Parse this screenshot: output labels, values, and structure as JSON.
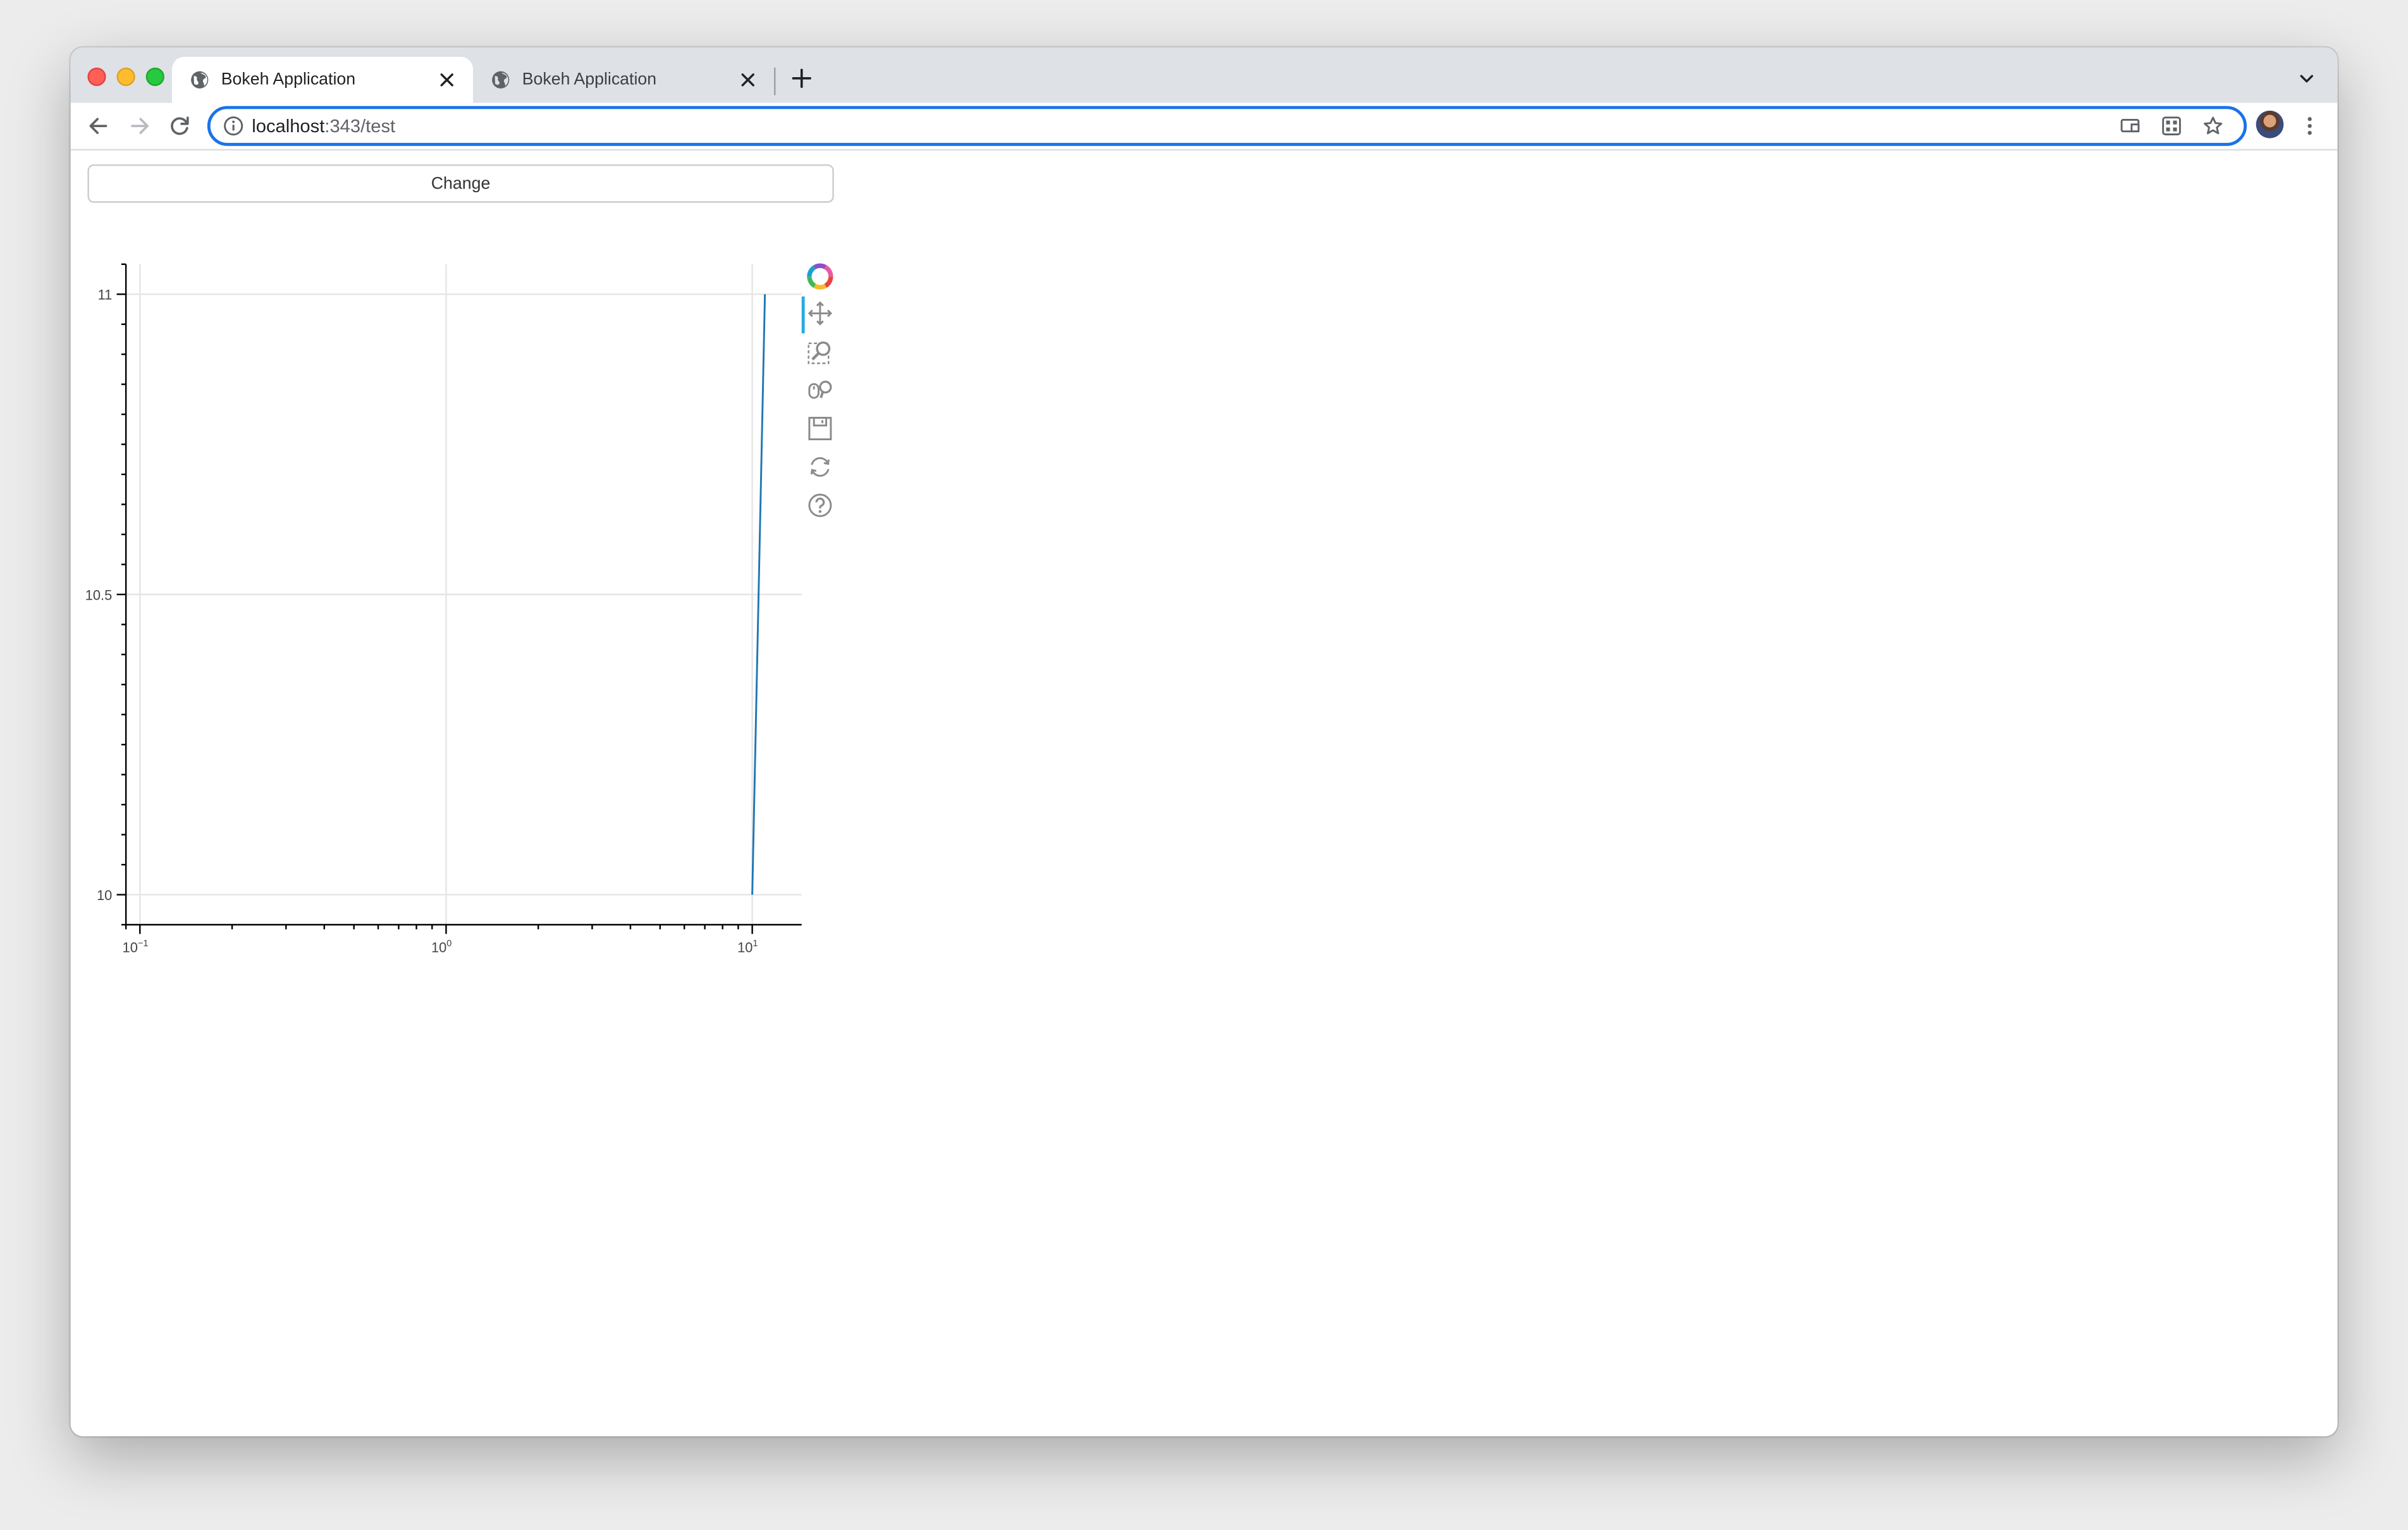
{
  "browser": {
    "tabs": [
      {
        "title": "Bokeh Application",
        "active": true
      },
      {
        "title": "Bokeh Application",
        "active": false
      }
    ],
    "url": {
      "host": "localhost",
      "path": ":343/test"
    }
  },
  "app": {
    "button_label": "Change"
  },
  "chart_data": {
    "type": "line",
    "x_axis": {
      "scale": "log",
      "range": [
        0.09,
        14.5
      ],
      "ticks": [
        0.1,
        1,
        10
      ],
      "tick_labels": [
        {
          "base": "10",
          "exp": "−1"
        },
        {
          "base": "10",
          "exp": "0"
        },
        {
          "base": "10",
          "exp": "1"
        }
      ]
    },
    "y_axis": {
      "scale": "linear",
      "range": [
        9.95,
        11.05
      ],
      "ticks": [
        10,
        10.5,
        11
      ],
      "tick_labels": [
        "10",
        "10.5",
        "11"
      ]
    },
    "grid": true,
    "series": [
      {
        "x": [
          10,
          11
        ],
        "y": [
          10,
          11
        ],
        "color": "#1f77b4"
      }
    ],
    "toolbar": [
      "bokeh-logo-icon",
      "pan-icon",
      "box-zoom-icon",
      "wheel-zoom-icon",
      "save-icon",
      "reset-icon",
      "help-icon"
    ]
  }
}
